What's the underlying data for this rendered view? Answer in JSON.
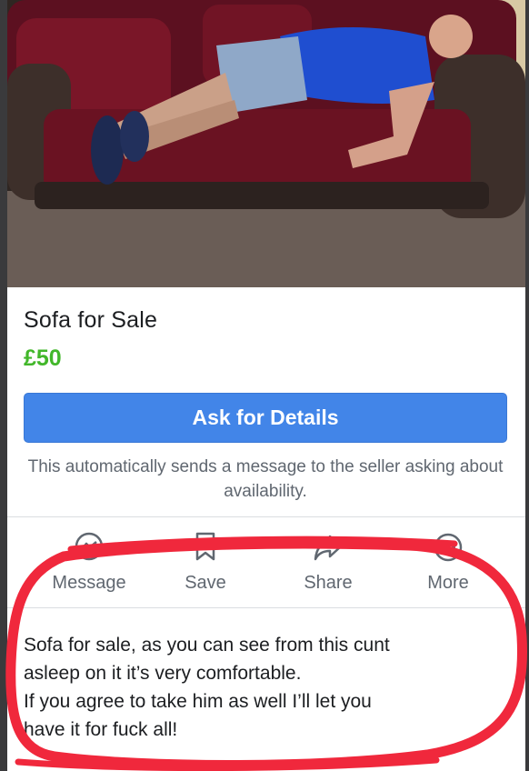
{
  "listing": {
    "title": "Sofa for Sale",
    "price": "£50",
    "ask_button_label": "Ask for Details",
    "ask_note": "This automatically sends a message to the seller asking about availability."
  },
  "actions": [
    {
      "label": "Message",
      "icon": "messenger-icon"
    },
    {
      "label": "Save",
      "icon": "bookmark-icon"
    },
    {
      "label": "Share",
      "icon": "share-icon"
    },
    {
      "label": "More",
      "icon": "more-icon"
    }
  ],
  "description": {
    "line1": "Sofa for sale, as you can see from this cunt",
    "line2": "asleep on it it’s very comfortable.",
    "line3": "If you agree to take him as well I’ll let you",
    "line4": "have it for fuck all!"
  },
  "colors": {
    "price": "#42b72a",
    "button": "#4285e8",
    "annotation": "#f0283c"
  }
}
